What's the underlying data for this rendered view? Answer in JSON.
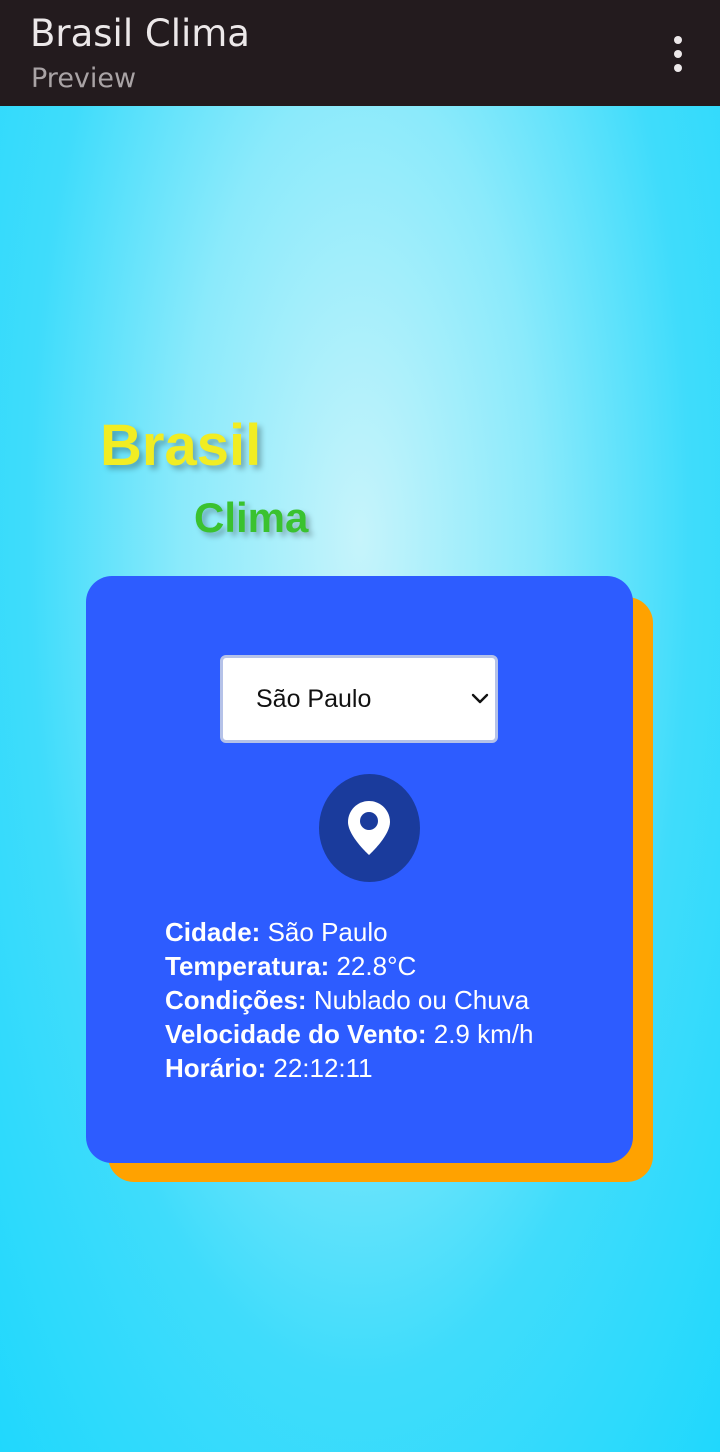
{
  "appbar": {
    "title": "Brasil Clima",
    "subtitle": "Preview",
    "menu_icon": "more-vert-icon"
  },
  "logo": {
    "line1": "Brasil",
    "line2": "Clima"
  },
  "city_select": {
    "selected": "São Paulo",
    "icon": "chevron-down-icon"
  },
  "location_icon": "location-pin-icon",
  "weather": {
    "city_label": "Cidade:",
    "city_value": "São Paulo",
    "temp_label": "Temperatura:",
    "temp_value": "22.8°C",
    "cond_label": "Condições:",
    "cond_value": "Nublado ou Chuva",
    "wind_label": "Velocidade do Vento:",
    "wind_value": "2.9 km/h",
    "time_label": "Horário:",
    "time_value": "22:12:11"
  },
  "colors": {
    "appbar": "#231b1e",
    "card": "#2d5cff",
    "card_shadow": "#ffa200",
    "logo_brasil": "#f1ed23",
    "logo_clima": "#3ac22f",
    "pin_circle": "#1a3b9c",
    "background": "#20d8fd"
  }
}
